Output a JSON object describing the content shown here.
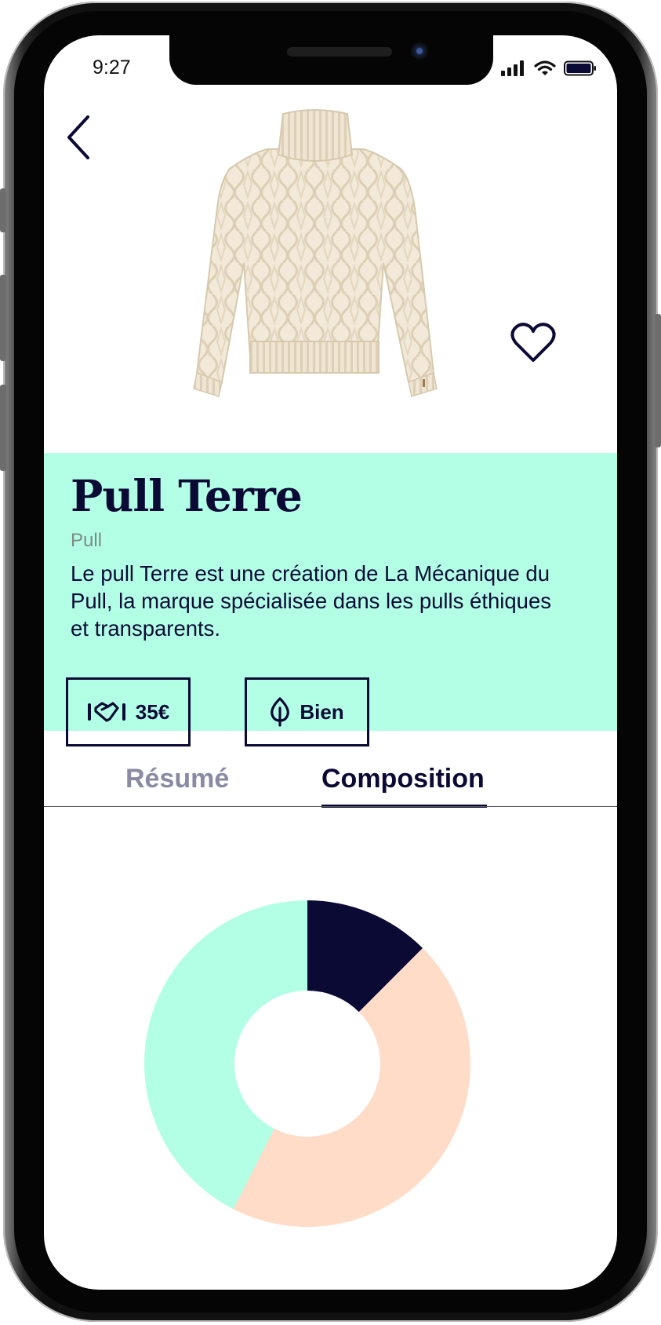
{
  "status_bar": {
    "time": "9:27"
  },
  "product": {
    "name": "Pull Terre",
    "category": "Pull",
    "description": "Le pull Terre est une création de La Mécanique du Pull, la marque spécialisée dans les pulls éthiques et transparents.",
    "price": "35€",
    "eco_rating": "Bien"
  },
  "tabs": [
    {
      "label": "Résumé",
      "active": false
    },
    {
      "label": "Composition",
      "active": true
    }
  ],
  "colors": {
    "accent": "#b2ffe6",
    "navy": "#0b0a35",
    "peach": "#ffdcc8"
  },
  "icons": [
    "back-chevron-icon",
    "heart-icon",
    "handshake-icon",
    "leaf-icon",
    "signal-icon",
    "wifi-icon",
    "battery-icon"
  ],
  "chart_data": {
    "type": "pie",
    "style": "donut",
    "values": [
      12.5,
      45,
      42.5
    ],
    "colors": [
      "#0b0a35",
      "#ffdcc8",
      "#b2ffe6"
    ]
  }
}
